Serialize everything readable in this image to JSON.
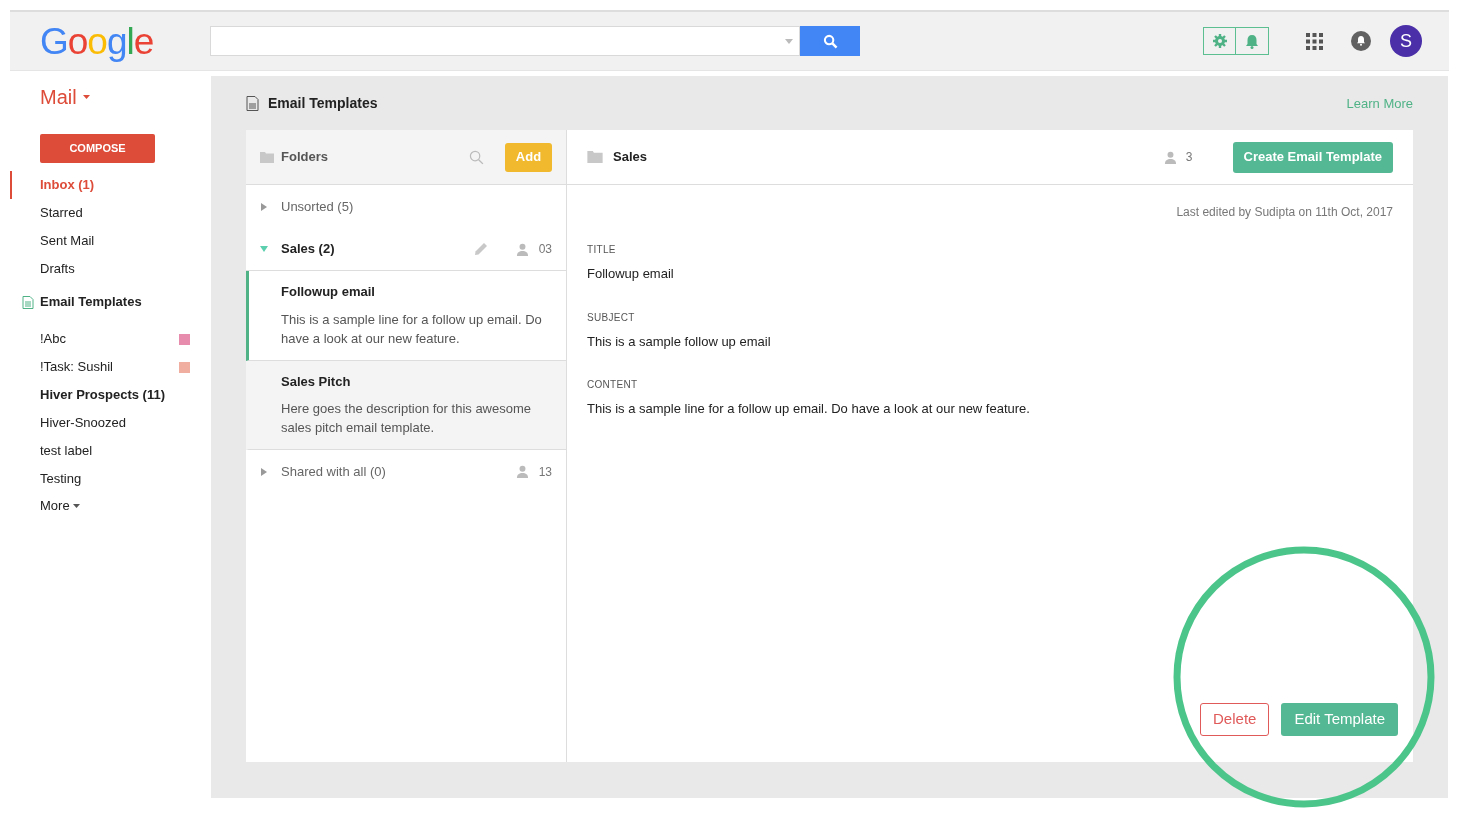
{
  "header": {
    "logo": "Google",
    "avatar": "S"
  },
  "sidebar": {
    "app_menu": "Mail",
    "compose": "COMPOSE",
    "items": [
      {
        "label": "Inbox (1)",
        "selected": true
      },
      {
        "label": "Starred",
        "selected": false
      },
      {
        "label": "Sent Mail",
        "selected": false
      },
      {
        "label": "Drafts",
        "selected": false
      }
    ],
    "templates_link": "Email Templates",
    "labels": [
      {
        "label": "!Abc",
        "bold": false,
        "color": "#e88cad"
      },
      {
        "label": "!Task: Sushil",
        "bold": false,
        "color": "#f0aea0"
      },
      {
        "label": "Hiver Prospects (11)",
        "bold": true
      },
      {
        "label": "Hiver-Snoozed",
        "bold": false
      },
      {
        "label": "test label",
        "bold": false
      },
      {
        "label": "Testing",
        "bold": false
      }
    ],
    "more": "More"
  },
  "main": {
    "title": "Email Templates",
    "learn_more": "Learn More",
    "folders_panel": {
      "title": "Folders",
      "add_button": "Add",
      "folders": [
        {
          "name": "Unsorted (5)",
          "expanded": false,
          "editable": false
        },
        {
          "name": "Sales (2)",
          "expanded": true,
          "editable": true,
          "count": "03",
          "templates": [
            {
              "title": "Followup email",
              "description": "This is a sample line for a follow up email. Do have a look at our new feature.",
              "selected": true
            },
            {
              "title": "Sales Pitch",
              "description": "Here goes the description for this awesome sales pitch email template.",
              "selected": false
            }
          ]
        },
        {
          "name": "Shared with all (0)",
          "expanded": false,
          "editable": false,
          "count": "13"
        }
      ]
    },
    "detail": {
      "folder": "Sales",
      "members": "3",
      "create_button": "Create Email Template",
      "last_edited": "Last edited by Sudipta on 11th Oct, 2017",
      "fields": [
        {
          "label": "TITLE",
          "value": "Followup email"
        },
        {
          "label": "SUBJECT",
          "value": "This is a sample follow up email"
        },
        {
          "label": "CONTENT",
          "value": "This is a sample line for a follow up email. Do have a look at our new feature."
        }
      ],
      "delete_button": "Delete",
      "edit_button": "Edit Template"
    }
  }
}
